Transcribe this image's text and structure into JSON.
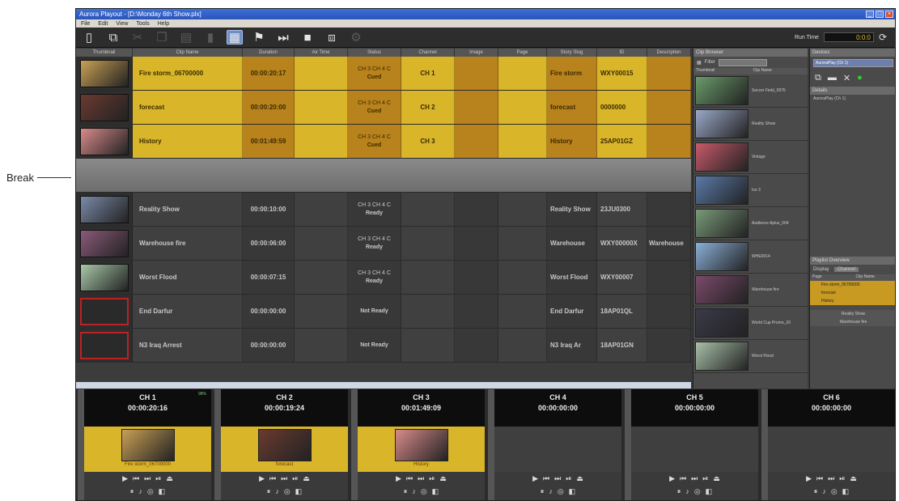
{
  "annotation": {
    "break_label": "Break"
  },
  "window": {
    "title": "Aurora Playout - [D:\\Monday 6th Show.plx]",
    "menus": [
      "File",
      "Edit",
      "View",
      "Tools",
      "Help"
    ]
  },
  "toolbar": {
    "buttons": [
      {
        "name": "new-icon",
        "glyph": "▯",
        "state": "normal"
      },
      {
        "name": "open-icon",
        "glyph": "⧉",
        "state": "normal"
      },
      {
        "name": "cut-icon",
        "glyph": "✂",
        "state": "dim"
      },
      {
        "name": "copy-icon",
        "glyph": "❐",
        "state": "dim"
      },
      {
        "name": "paste-icon",
        "glyph": "▤",
        "state": "dim"
      },
      {
        "name": "delete-icon",
        "glyph": "▮",
        "state": "dim"
      },
      {
        "name": "list-view-icon",
        "glyph": "▦",
        "state": "selected"
      },
      {
        "name": "flag-icon",
        "glyph": "⚑",
        "state": "normal"
      },
      {
        "name": "skip-next-icon",
        "glyph": "⏭",
        "state": "normal"
      },
      {
        "name": "stop-icon",
        "glyph": "■",
        "state": "normal"
      },
      {
        "name": "clip-icon",
        "glyph": "⧈",
        "state": "normal"
      },
      {
        "name": "settings-dim-icon",
        "glyph": "⚙",
        "state": "dim"
      }
    ],
    "runtime_label": "Run Time",
    "runtime_value": "0:0:0",
    "refresh_glyph": "⟳"
  },
  "playlist": {
    "columns": [
      "Thumbnail",
      "Clip Name",
      "Duration",
      "Air Time",
      "Status",
      "Channel",
      "Image",
      "Page",
      "Story Slug",
      "ID",
      "Description"
    ],
    "cued_rows": [
      {
        "name": "Fire storm_06700000",
        "duration": "00:00:20:17",
        "status_top": "CH 3 CH 4 C",
        "status": "Cued",
        "channel": "CH 1",
        "slug": "Fire storm",
        "id": "WXY00015",
        "thumb": "#c9a055"
      },
      {
        "name": "forecast",
        "duration": "00:00:20:00",
        "status_top": "CH 3 CH 4 C",
        "status": "Cued",
        "channel": "CH 2",
        "slug": "forecast",
        "id": "0000000",
        "thumb": "#6a3a30"
      },
      {
        "name": "History",
        "duration": "00:01:49:59",
        "status_top": "CH 3 CH 4 C",
        "status": "Cued",
        "channel": "CH 3",
        "slug": "History",
        "id": "25AP01GZ",
        "thumb": "#d88a8a"
      }
    ],
    "idle_rows": [
      {
        "name": "Reality Show",
        "duration": "00:00:10:00",
        "status_top": "CH 3 CH 4 C",
        "status": "Ready",
        "slug": "Reality Show",
        "id": "23JU0300",
        "desc": "",
        "thumb": "#7a8aa8",
        "empty": false
      },
      {
        "name": "Warehouse fire",
        "duration": "00:00:06:00",
        "status_top": "CH 3 CH 4 C",
        "status": "Ready",
        "slug": "Warehouse",
        "id": "WXY00000X",
        "desc": "Warehouse",
        "thumb": "#8a5a7a",
        "empty": false
      },
      {
        "name": "Worst Flood",
        "duration": "00:00:07:15",
        "status_top": "CH 3 CH 4 C",
        "status": "Ready",
        "slug": "Worst Flood",
        "id": "WXY00007",
        "desc": "",
        "thumb": "#a8c8a8",
        "empty": false
      },
      {
        "name": "End Darfur",
        "duration": "00:00:00:00",
        "status_top": "",
        "status": "Not Ready",
        "slug": "End Darfur",
        "id": "18AP01QL",
        "desc": "",
        "thumb": "",
        "empty": true
      },
      {
        "name": "N3 Iraq Arrest",
        "duration": "00:00:00:00",
        "status_top": "",
        "status": "Not Ready",
        "slug": "N3 Iraq Ar",
        "id": "18AP01GN",
        "desc": "",
        "thumb": "",
        "empty": true
      }
    ]
  },
  "clip_browser": {
    "header": "Clip Browser",
    "filter_label": "Filter",
    "cols": [
      "Thumbnail",
      "Clip Name"
    ],
    "items": [
      {
        "name": "Soccer Field_0976",
        "color": "#6a9a6a"
      },
      {
        "name": "Reality Show",
        "color": "#9aa8c8"
      },
      {
        "name": "Vintage",
        "color": "#c85a6a"
      },
      {
        "name": "Ice 3",
        "color": "#5a7aa8"
      },
      {
        "name": "Audience Aplus_004",
        "color": "#7a9a7a"
      },
      {
        "name": "WHE0014",
        "color": "#8ab0d8"
      },
      {
        "name": "Warehouse fire",
        "color": "#7a4a6a"
      },
      {
        "name": "World Cup Promo_20",
        "color": "#3a3a4a"
      },
      {
        "name": "Worst Flood",
        "color": "#a8c0a8"
      }
    ]
  },
  "right_pane": {
    "devices_header": "Devices",
    "device_name": "AuroraPlay (Ch 1)",
    "details_header": "Details",
    "details_value": "AuroraPlay (Ch 1)",
    "overview_header": "Playlist Overview",
    "display_label": "Display",
    "display_value": "Channel",
    "overview_cols": [
      "Page",
      "Clip Name"
    ],
    "overview_cued": [
      "Fire storm_06700000",
      "forecast",
      "History"
    ],
    "overview_idle": [
      "Reality Show",
      "Warehouse fire"
    ]
  },
  "channels": [
    {
      "label": "CH 1",
      "time": "00:00:20:16",
      "clip": "Fire storm_06700000",
      "active": true,
      "pct": "98%",
      "color": "#c9a055"
    },
    {
      "label": "CH 2",
      "time": "00:00:19:24",
      "clip": "forecast",
      "active": true,
      "pct": "",
      "color": "#6a3a30"
    },
    {
      "label": "CH 3",
      "time": "00:01:49:09",
      "clip": "History",
      "active": true,
      "pct": "",
      "color": "#d88a8a"
    },
    {
      "label": "CH 4",
      "time": "00:00:00:00",
      "clip": "",
      "active": false,
      "pct": "",
      "color": ""
    },
    {
      "label": "CH 5",
      "time": "00:00:00:00",
      "clip": "",
      "active": false,
      "pct": "",
      "color": ""
    },
    {
      "label": "CH 6",
      "time": "00:00:00:00",
      "clip": "",
      "active": false,
      "pct": "",
      "color": ""
    }
  ],
  "channel_controls": {
    "row1": [
      "▶",
      "⏮",
      "⏭",
      "⏯",
      "⏏"
    ],
    "row2": [
      "⏸",
      "♪",
      "◎",
      "◧"
    ]
  }
}
